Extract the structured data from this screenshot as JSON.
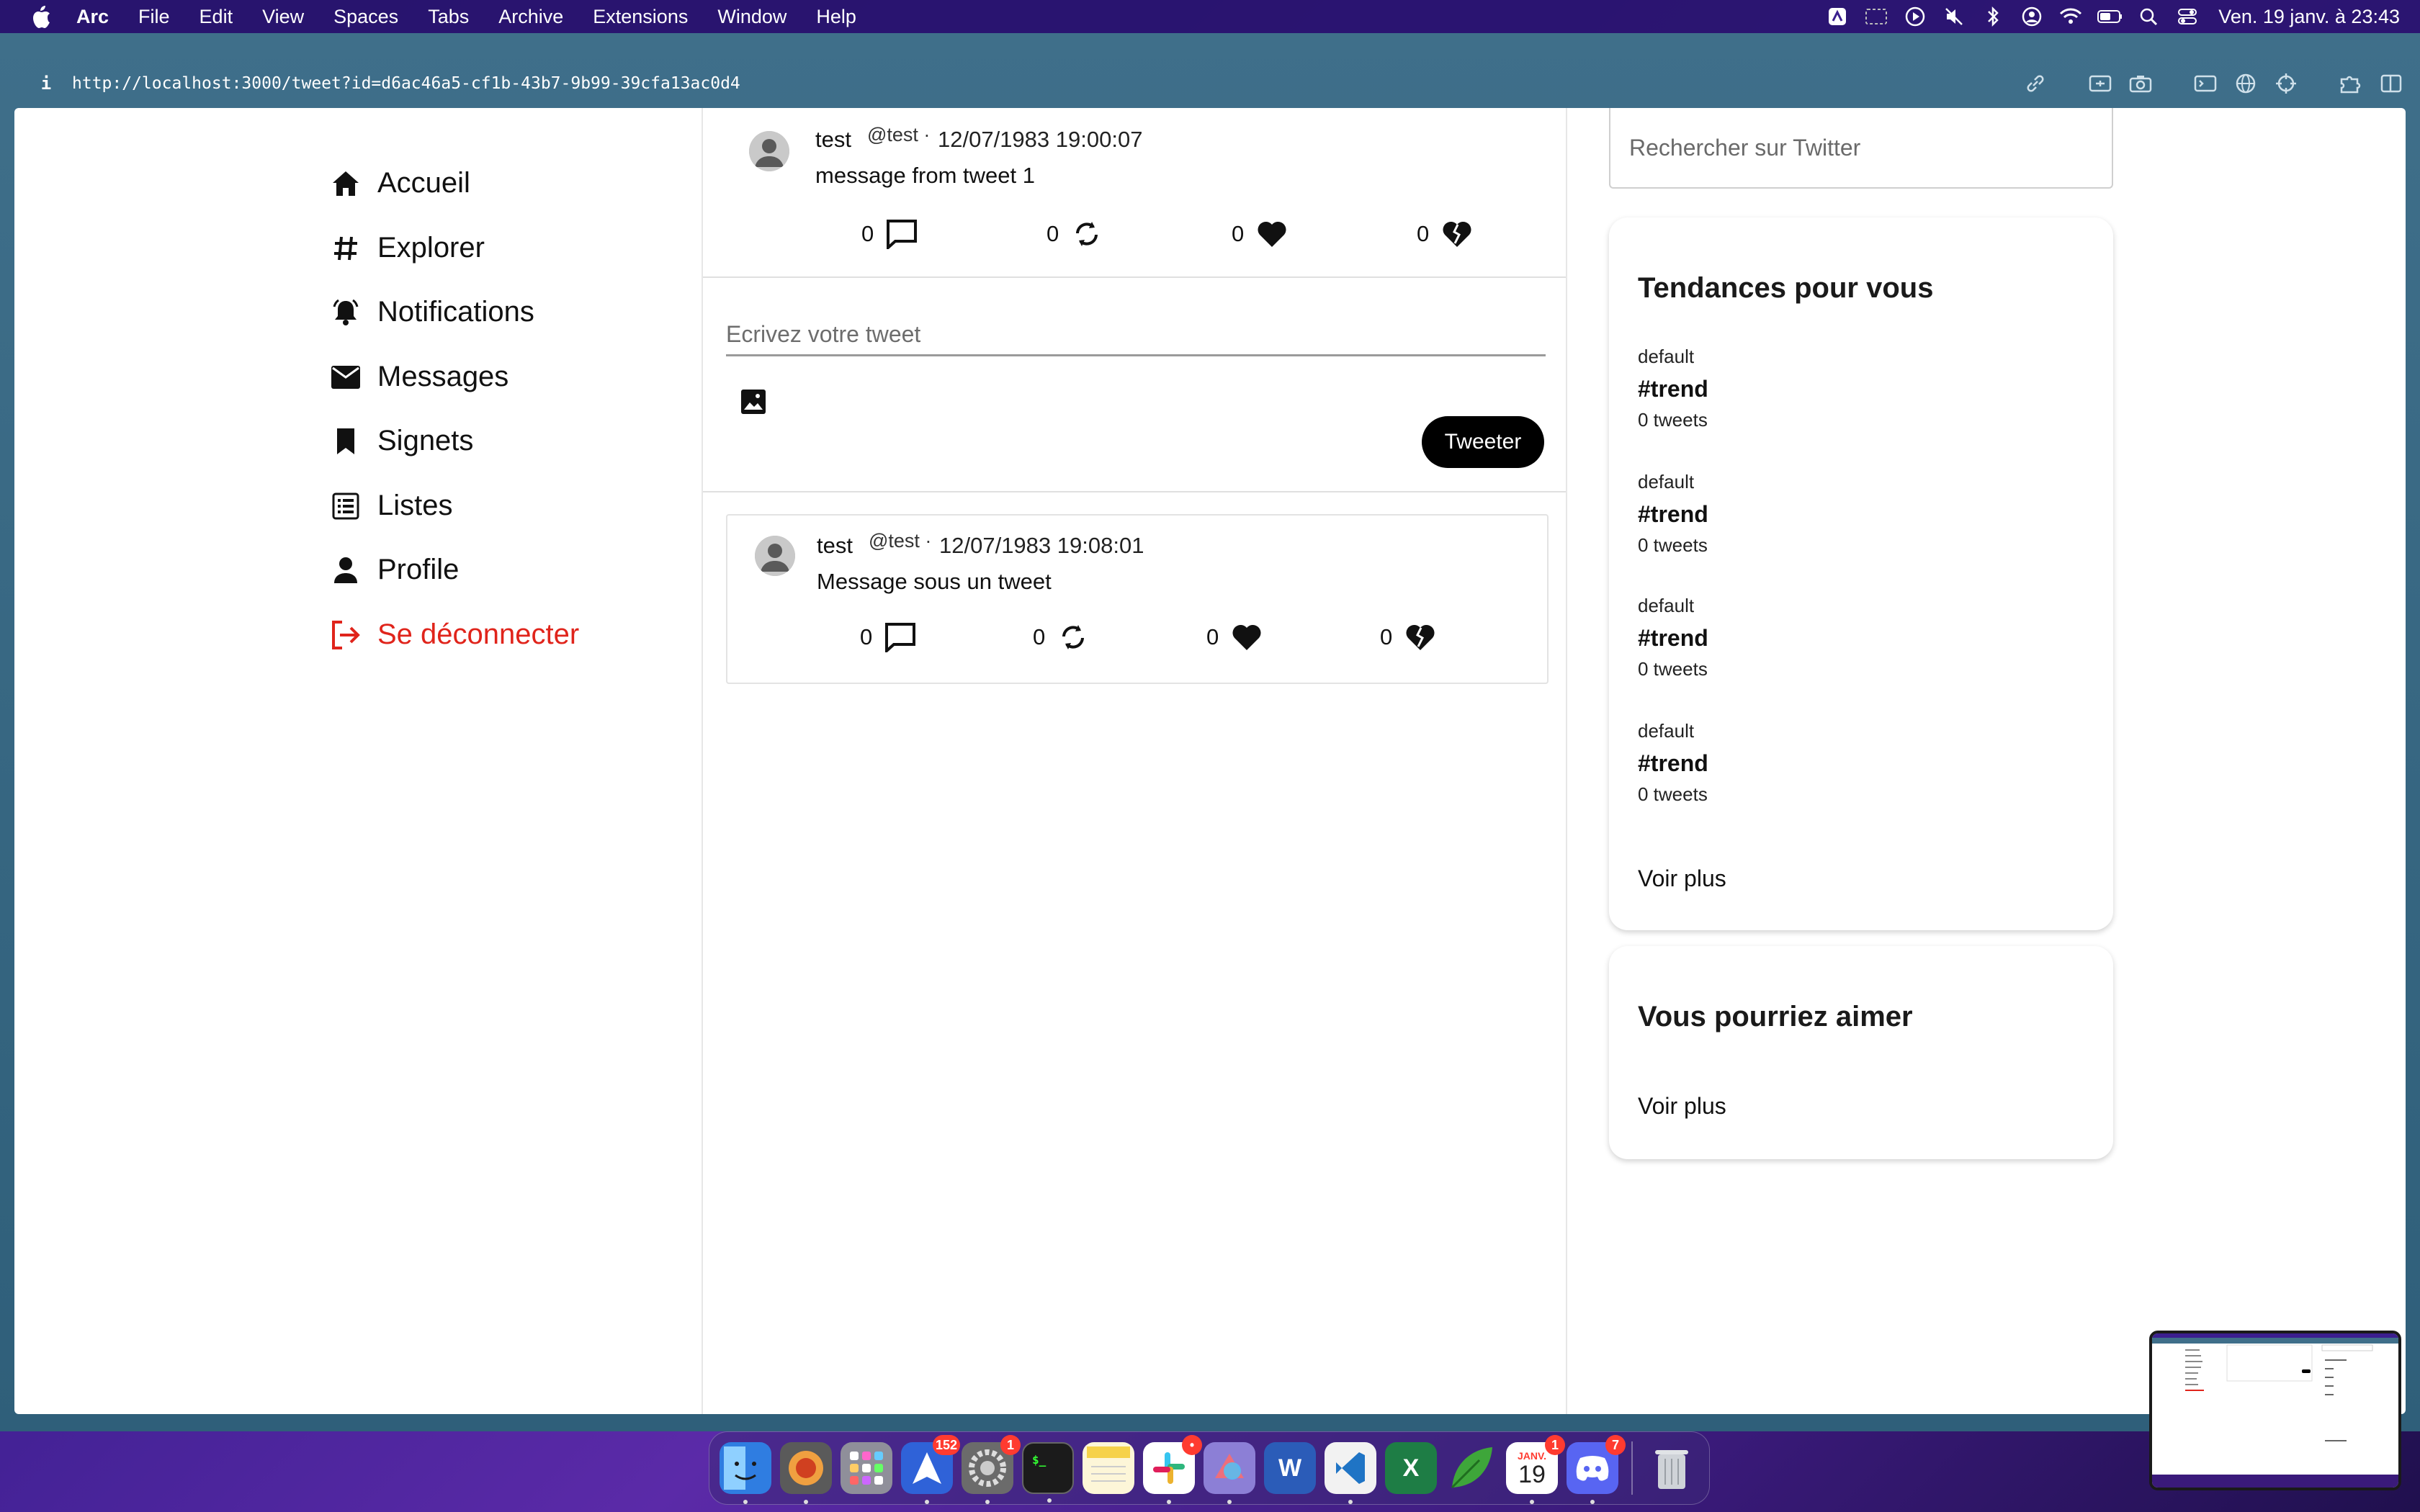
{
  "menubar": {
    "app_name": "Arc",
    "items": [
      "File",
      "Edit",
      "View",
      "Spaces",
      "Tabs",
      "Archive",
      "Extensions",
      "Window",
      "Help"
    ],
    "clock": "Ven. 19 janv. à 23:43",
    "status_icons": [
      "arc-icon",
      "screen-icon",
      "play-icon",
      "mute-icon",
      "bluetooth-icon",
      "user-icon",
      "wifi-icon",
      "battery-icon",
      "search-icon",
      "control-center-icon"
    ]
  },
  "browser": {
    "info": "i",
    "url": "http://localhost:3000/tweet?id=d6ac46a5-cf1b-43b7-9b99-39cfa13ac0d4"
  },
  "nav": {
    "items": [
      {
        "label": "Accueil",
        "icon": "home-icon"
      },
      {
        "label": "Explorer",
        "icon": "hashtag-icon"
      },
      {
        "label": "Notifications",
        "icon": "bell-icon"
      },
      {
        "label": "Messages",
        "icon": "mail-icon"
      },
      {
        "label": "Signets",
        "icon": "bookmark-icon"
      },
      {
        "label": "Listes",
        "icon": "list-icon"
      },
      {
        "label": "Profile",
        "icon": "person-icon"
      }
    ],
    "logout": "Se déconnecter",
    "logout_color": "#e0241b"
  },
  "main_tweet": {
    "name": "test",
    "handle": "@test ·",
    "date": "12/07/1983 19:00:07",
    "text": "message from tweet 1",
    "comments": "0",
    "retweets": "0",
    "likes": "0",
    "dislikes": "0"
  },
  "compose": {
    "placeholder": "Ecrivez votre tweet",
    "button": "Tweeter"
  },
  "reply": {
    "name": "test",
    "handle": "@test ·",
    "date": "12/07/1983 19:08:01",
    "text": "Message sous un tweet",
    "comments": "0",
    "retweets": "0",
    "likes": "0",
    "dislikes": "0"
  },
  "search": {
    "placeholder": "Rechercher sur Twitter"
  },
  "trends": {
    "title": "Tendances pour vous",
    "items": [
      {
        "category": "default",
        "tag": "#trend",
        "count": "0 tweets"
      },
      {
        "category": "default",
        "tag": "#trend",
        "count": "0 tweets"
      },
      {
        "category": "default",
        "tag": "#trend",
        "count": "0 tweets"
      },
      {
        "category": "default",
        "tag": "#trend",
        "count": "0 tweets"
      }
    ],
    "more": "Voir plus"
  },
  "suggestions": {
    "title": "Vous pourriez aimer",
    "more": "Voir plus"
  },
  "dock": {
    "apps": [
      {
        "name": "Finder",
        "color": "#2f7de1"
      },
      {
        "name": "Pie",
        "color": "#cc6a2b"
      },
      {
        "name": "Launchpad",
        "color": "#8f8f9a"
      },
      {
        "name": "Direct Mail",
        "color": "#2f62d8",
        "badge": "152"
      },
      {
        "name": "System Settings",
        "color": "#6b6b6b",
        "badge": "1"
      },
      {
        "name": "Terminal",
        "color": "#1b1b1b"
      },
      {
        "name": "Notes",
        "color": "#f6d24a"
      },
      {
        "name": "Slack",
        "color": "#ffffff",
        "badge": "•"
      },
      {
        "name": "Figma",
        "color": "#6f58c9"
      },
      {
        "name": "Word",
        "color": "#2b5cb8"
      },
      {
        "name": "VS Code",
        "color": "#1f74c5"
      },
      {
        "name": "Excel",
        "color": "#1e7d45"
      },
      {
        "name": "Leaf",
        "color": "#3ea63a"
      },
      {
        "name": "Calendar",
        "color": "#ffffff",
        "badge": "1",
        "month": "JANV.",
        "day": "19"
      },
      {
        "name": "Discord",
        "color": "#5865f2",
        "badge": "7"
      }
    ],
    "trash": "Trash"
  }
}
